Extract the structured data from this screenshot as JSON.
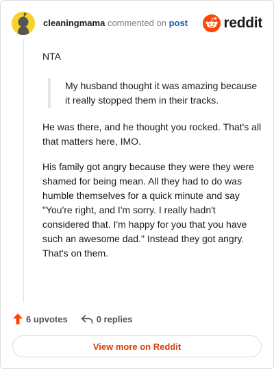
{
  "comment": {
    "username": "cleaningmama",
    "action_text": "commented on",
    "post_link": "post",
    "paragraphs": [
      "NTA",
      "He was there, and he thought you rocked. That's all that matters here, IMO.",
      "His family got angry because they were they were shamed for being mean. All they had to do was humble themselves for a quick minute and say \"You're right, and I'm sorry. I really hadn't considered that. I'm happy for you that you have such an awesome dad.\" Instead they got angry. That's on them."
    ],
    "quote": "My husband thought it was amazing because it really stopped them in their tracks."
  },
  "logo": {
    "text": "reddit",
    "icon": "reddit-snoo-icon",
    "color": "#ff4500"
  },
  "actions": {
    "upvotes": "6 upvotes",
    "replies": "0 replies",
    "upvote_icon": "upvote-arrow-icon",
    "reply_icon": "reply-arrow-icon"
  },
  "view_more": "View more on Reddit",
  "colors": {
    "accent": "#ff4500",
    "link": "#0f5fb8",
    "button_text": "#d93a00",
    "avatar": "#f5d32b"
  }
}
